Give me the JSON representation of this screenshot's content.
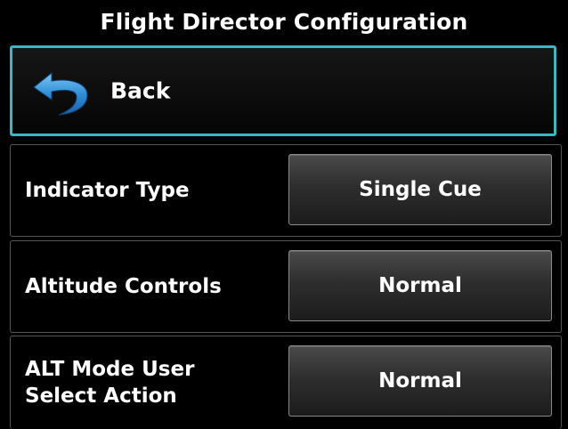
{
  "header": {
    "title": "Flight Director Configuration"
  },
  "back": {
    "label": "Back",
    "icon": "back-arrow-icon",
    "border_color": "#3ab6c4",
    "icon_color": "#2f8fd6"
  },
  "settings": [
    {
      "label": "Indicator Type",
      "value": "Single Cue"
    },
    {
      "label": "Altitude Controls",
      "value": "Normal"
    },
    {
      "label": "ALT Mode User\nSelect Action",
      "value": "Normal"
    }
  ]
}
